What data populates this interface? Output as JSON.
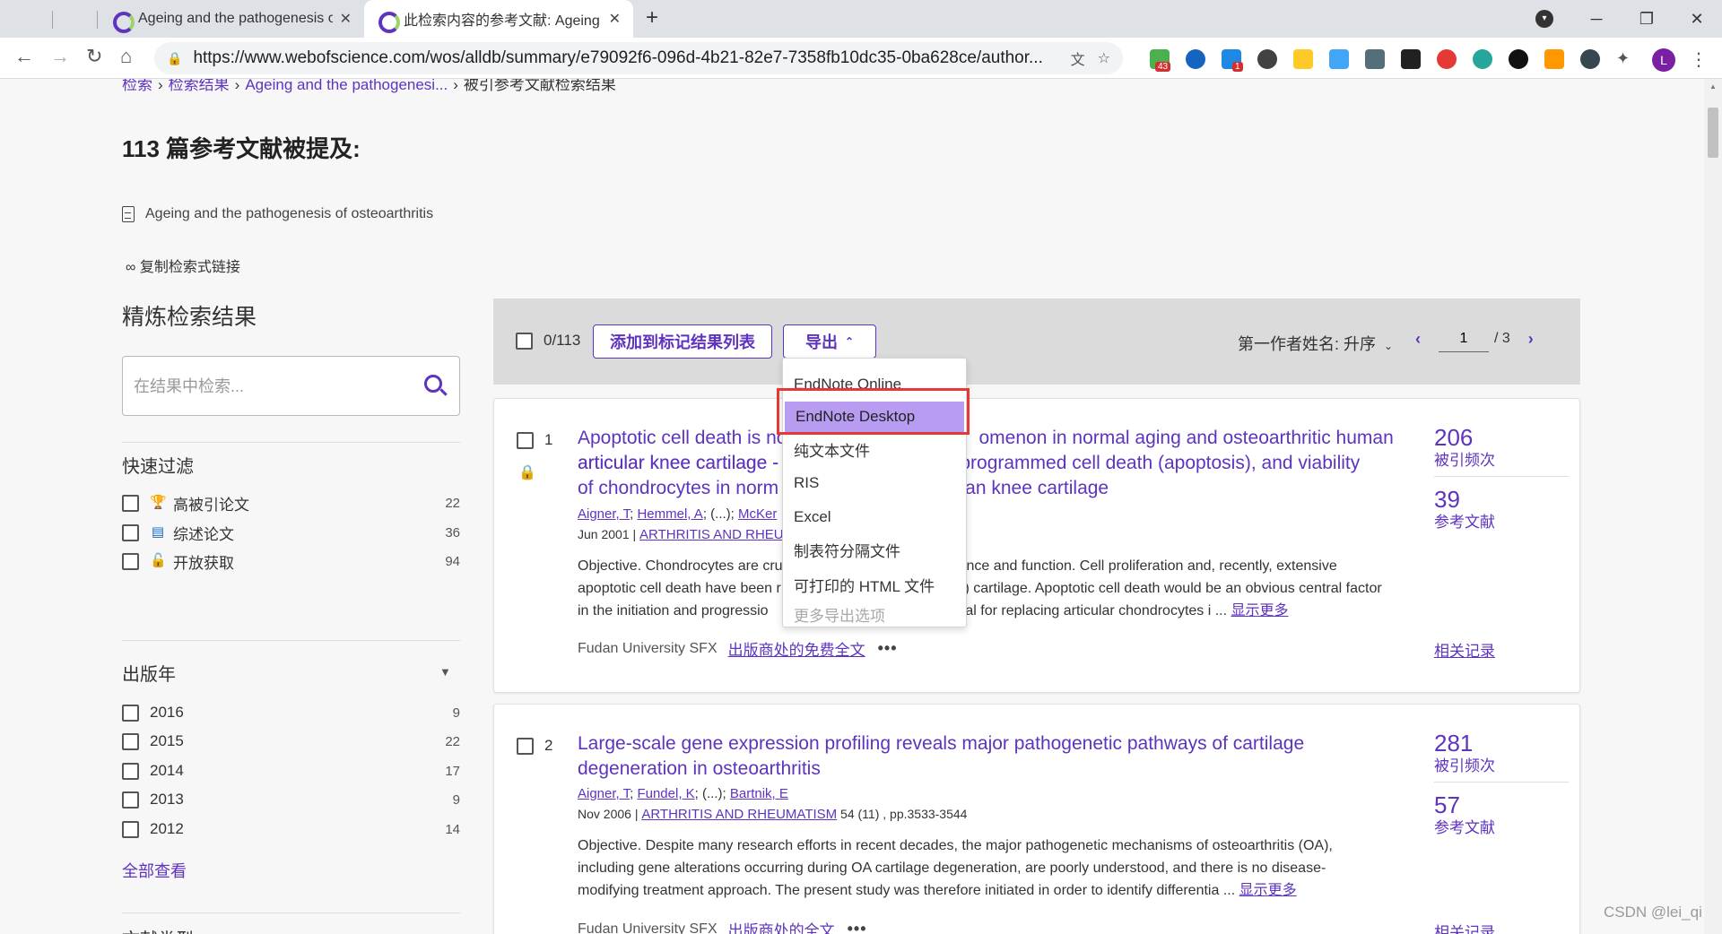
{
  "browser": {
    "tabs": [
      {
        "title": "Ageing and the pathogenesis of"
      },
      {
        "title": "此检索内容的参考文献: Ageing"
      }
    ],
    "url": "https://www.webofscience.com/wos/alldb/summary/e79092f6-096d-4b21-82e7-7358fb10dc35-0ba628ce/author...",
    "extension_badges": [
      "43",
      "1"
    ],
    "profile_initial": "L"
  },
  "breadcrumb": {
    "items": [
      "检索",
      "检索结果",
      "Ageing and the pathogenesi...",
      "被引参考文献检索结果"
    ]
  },
  "page": {
    "title": "113 篇参考文献被提及:",
    "source_title": "Ageing and the pathogenesis of osteoarthritis",
    "copy_link": "复制检索式链接"
  },
  "sidebar": {
    "refine_title": "精炼检索结果",
    "search_placeholder": "在结果中检索...",
    "quick_filter_title": "快速过滤",
    "quick_filters": [
      {
        "label": "高被引论文",
        "count": "22",
        "icon": "trophy-icon",
        "icon_color": "#e64a19"
      },
      {
        "label": "综述论文",
        "count": "36",
        "icon": "document-icon",
        "icon_color": "#1565c0"
      },
      {
        "label": "开放获取",
        "count": "94",
        "icon": "lock-open-icon",
        "icon_color": "#222222"
      }
    ],
    "year_title": "出版年",
    "years": [
      {
        "label": "2016",
        "count": "9"
      },
      {
        "label": "2015",
        "count": "22"
      },
      {
        "label": "2014",
        "count": "17"
      },
      {
        "label": "2013",
        "count": "9"
      },
      {
        "label": "2012",
        "count": "14"
      }
    ],
    "view_all": "全部查看",
    "next_section": "文献类型"
  },
  "toolbar": {
    "selected": "0/113",
    "add_to_marked": "添加到标记结果列表",
    "export_label": "导出",
    "sort_label": "第一作者姓名: 升序",
    "page_current": "1",
    "page_total": "/ 3"
  },
  "export_menu": {
    "items": [
      {
        "label": "EndNote Online"
      },
      {
        "label": "EndNote Desktop",
        "highlighted": true
      },
      {
        "label": "纯文本文件"
      },
      {
        "label": "RIS"
      },
      {
        "label": "Excel"
      },
      {
        "label": "制表符分隔文件"
      },
      {
        "label": "可打印的 HTML 文件"
      },
      {
        "label": "更多导出选项",
        "disabled": true
      }
    ]
  },
  "results": [
    {
      "index": "1",
      "title_before": "Apoptotic cell death is no",
      "title_after": "omenon in normal aging and osteoarthritic human articular knee cartilage -",
      "title_line2_after": "n, programmed cell death (apoptosis), and viability of chondrocytes in norm",
      "title_line3_after": "uman knee cartilage",
      "authors": [
        "Aigner, T",
        "Hemmel, A",
        "(...)",
        "McKer"
      ],
      "date": "Jun 2001",
      "journal": "ARTHRITIS AND RHEU",
      "abstract_lines": [
        {
          "left": "Objective. Chondrocytes are cru",
          "right": "ance and function. Cell proliferation and, recently, extensive"
        },
        {
          "left": "apoptotic cell death have been r",
          "right": "A) cartilage. Apoptotic cell death would be an obvious central factor"
        },
        {
          "left": "in the initiation and progressio",
          "right": "ential for replacing articular chondrocytes i"
        }
      ],
      "show_more": "显示更多",
      "sfx": "Fudan University SFX",
      "fulltext": "出版商处的免费全文",
      "times_cited": "206",
      "times_cited_label": "被引频次",
      "references": "39",
      "references_label": "参考文献",
      "related": "相关记录"
    },
    {
      "index": "2",
      "title": "Large-scale gene expression profiling reveals major pathogenetic pathways of cartilage degeneration in osteoarthritis",
      "authors": [
        "Aigner, T",
        "Fundel, K",
        "(...)",
        "Bartnik, E"
      ],
      "date": "Nov 2006",
      "journal": "ARTHRITIS AND RHEUMATISM",
      "volume": "54 (11) , pp.3533-3544",
      "abstract_lines": [
        "Objective. Despite many research efforts in recent decades, the major pathogenetic mechanisms of osteoarthritis (OA),",
        "including gene alterations occurring during OA cartilage degeneration, are poorly understood, and there is no disease-",
        "modifying treatment approach. The present study was therefore initiated in order to identify differentia"
      ],
      "show_more": "显示更多",
      "sfx": "Fudan University SFX",
      "fulltext": "出版商处的全文",
      "times_cited": "281",
      "times_cited_label": "被引频次",
      "references": "57",
      "references_label": "参考文献",
      "related": "相关记录"
    }
  ],
  "watermark": "CSDN @lei_qi"
}
